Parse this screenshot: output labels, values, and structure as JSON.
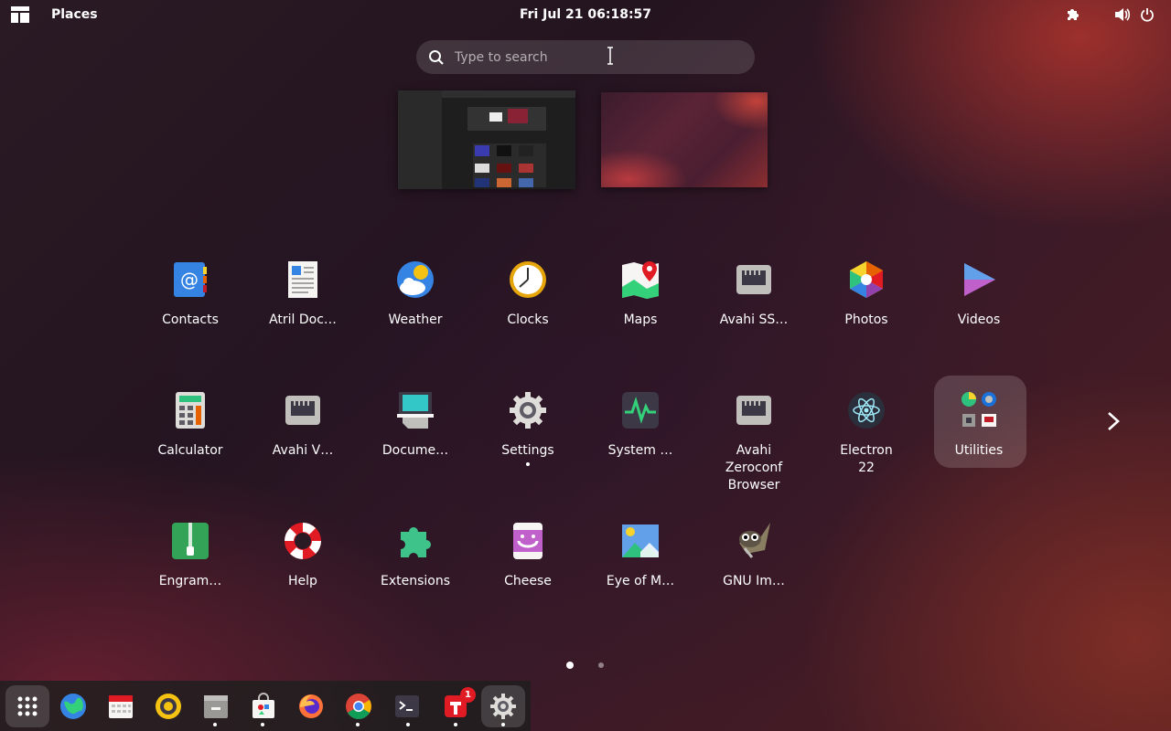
{
  "topbar": {
    "places_label": "Places",
    "clock": "Fri Jul 21  06:18:57",
    "icons": [
      "activities-icon",
      "extensions-icon",
      "volume-icon",
      "power-icon"
    ]
  },
  "search": {
    "placeholder": "Type to search"
  },
  "apps": [
    {
      "label": "Contacts",
      "icon": "contacts-icon"
    },
    {
      "label": "Atril Doc…",
      "icon": "atril-icon"
    },
    {
      "label": "Weather",
      "icon": "weather-icon"
    },
    {
      "label": "Clocks",
      "icon": "clocks-icon"
    },
    {
      "label": "Maps",
      "icon": "maps-icon"
    },
    {
      "label": "Avahi SS…",
      "icon": "network-icon"
    },
    {
      "label": "Photos",
      "icon": "photos-icon"
    },
    {
      "label": "Videos",
      "icon": "videos-icon"
    },
    {
      "label": "Calculator",
      "icon": "calculator-icon"
    },
    {
      "label": "Avahi V…",
      "icon": "network-icon"
    },
    {
      "label": "Docume…",
      "icon": "document-scanner-icon"
    },
    {
      "label": "Settings",
      "icon": "gear-icon",
      "running": true
    },
    {
      "label": "System …",
      "icon": "system-monitor-icon"
    },
    {
      "label": "Avahi Zeroconf Browser",
      "icon": "network-icon"
    },
    {
      "label": "Electron 22",
      "icon": "electron-icon"
    },
    {
      "label": "Utilities",
      "icon": "folder-icon"
    },
    {
      "label": "Engram…",
      "icon": "archive-icon"
    },
    {
      "label": "Help",
      "icon": "help-icon"
    },
    {
      "label": "Extensions",
      "icon": "puzzle-icon"
    },
    {
      "label": "Cheese",
      "icon": "cheese-icon"
    },
    {
      "label": "Eye of M…",
      "icon": "image-viewer-icon"
    },
    {
      "label": "GNU Im…",
      "icon": "gimp-icon"
    }
  ],
  "pager": {
    "pages": 2,
    "current": 1
  },
  "dock": [
    {
      "name": "app-grid",
      "icon": "grid-icon"
    },
    {
      "name": "browser",
      "icon": "globe-icon"
    },
    {
      "name": "calendar",
      "icon": "calendar-icon"
    },
    {
      "name": "rhythmbox",
      "icon": "music-icon"
    },
    {
      "name": "files",
      "icon": "files-icon",
      "running": true
    },
    {
      "name": "software",
      "icon": "software-icon",
      "running": true
    },
    {
      "name": "firefox",
      "icon": "firefox-icon"
    },
    {
      "name": "chrome",
      "icon": "chrome-icon",
      "running": true
    },
    {
      "name": "terminal",
      "icon": "terminal-icon",
      "running": true
    },
    {
      "name": "todo",
      "icon": "todo-icon",
      "running": true,
      "badge": "1"
    },
    {
      "name": "settings",
      "icon": "gear-icon",
      "running": true
    }
  ],
  "colors": {
    "accent": "#e01b24",
    "panel": "#1e1e1e",
    "folder_highlight": "#ffffff"
  }
}
